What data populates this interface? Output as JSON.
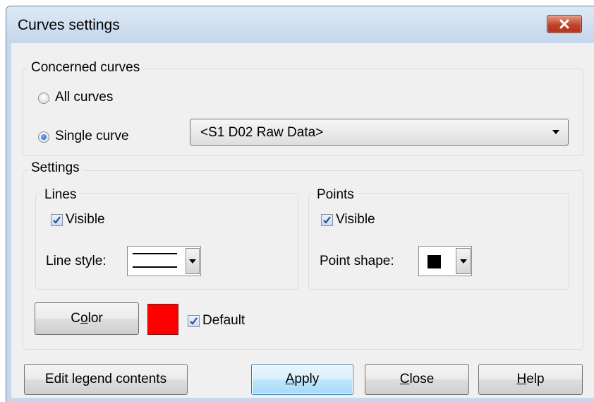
{
  "window": {
    "title": "Curves settings"
  },
  "concerned": {
    "title": "Concerned curves",
    "all_curves": {
      "label": "All curves",
      "checked": false
    },
    "single_curve": {
      "label": "Single curve",
      "checked": true
    },
    "curve_select": {
      "value": "<S1 D02 Raw Data>"
    }
  },
  "settings": {
    "title": "Settings",
    "lines": {
      "title": "Lines",
      "visible": {
        "label": "Visible",
        "checked": true
      },
      "style_label": "Line style:"
    },
    "points": {
      "title": "Points",
      "visible": {
        "label": "Visible",
        "checked": true
      },
      "shape_label": "Point shape:"
    },
    "color_button": {
      "pre": "C",
      "mnemonic": "o",
      "post": "lor"
    },
    "color_swatch": "#ff0000",
    "default": {
      "label": "Default",
      "checked": true
    }
  },
  "buttons": {
    "edit_legend": "Edit legend contents",
    "apply": {
      "mnemonic": "A",
      "post": "pply"
    },
    "close": {
      "mnemonic": "C",
      "post": "lose"
    },
    "help": {
      "mnemonic": "H",
      "post": "elp"
    }
  },
  "colors": {
    "accent": "#3c7fb1",
    "close_button": "#c0432b",
    "titlebar": "#c4d6ec"
  }
}
